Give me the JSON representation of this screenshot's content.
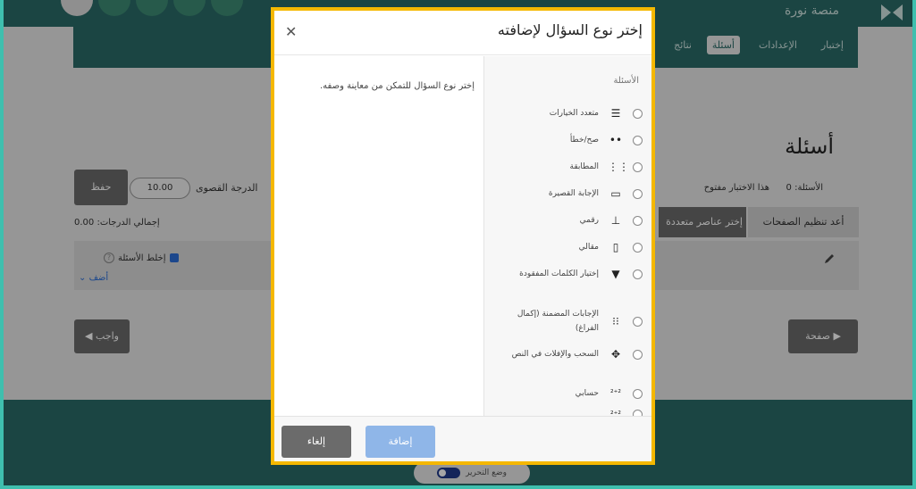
{
  "app": {
    "brand": "منصة نورة"
  },
  "tabs": [
    {
      "label": "إختبار"
    },
    {
      "label": "الإعدادات"
    },
    {
      "label": "أسئلة"
    },
    {
      "label": "نتائج"
    }
  ],
  "page": {
    "title": "أسئلة",
    "questions_count": "الأسئلة: 0",
    "quiz_open": "هذا الاختبار مفتوح",
    "max_grade_label": "الدرجة القصوى",
    "max_grade_value": "10.00",
    "save": "حفظ",
    "total_grades": "إجمالي الدرجات: 0.00",
    "reorder_pages": "أعد تنظيم الصفحات",
    "select_multiple": "إختر عناصر متعددة",
    "shuffle_questions": "إخلط الأسئلة",
    "add": "أضف",
    "page_btn": "صفحة",
    "required_btn": "واجب",
    "edit_mode": "وضع التحرير"
  },
  "modal": {
    "title": "إختر نوع السؤال لإضافته",
    "list_heading": "الأسئلة",
    "description": "إختر نوع السؤال للتمكن من معاينة وصفه.",
    "add_button": "إضافة",
    "cancel_button": "إلغاء",
    "question_types": [
      {
        "label": "متعدد الخيارات",
        "icon": "list-bullets-icon",
        "glyph": "☰"
      },
      {
        "label": "صح/خطأ",
        "icon": "two-dots-icon",
        "glyph": "••"
      },
      {
        "label": "المطابقة",
        "icon": "matching-grid-icon",
        "glyph": "⋮⋮"
      },
      {
        "label": "الإجابة القصيرة",
        "icon": "short-answer-icon",
        "glyph": "▭"
      },
      {
        "label": "رقمي",
        "icon": "numeric-icon",
        "glyph": "⊥"
      },
      {
        "label": "مقالي",
        "icon": "essay-icon",
        "glyph": "▯"
      },
      {
        "label": "إختيار الكلمات المفقودة",
        "icon": "dropdown-icon",
        "glyph": "▼"
      },
      {
        "label": "الإجابات المضمنة (إكمال الفراغ)",
        "icon": "embedded-answers-icon",
        "glyph": "⁝⁝"
      },
      {
        "label": "السحب والإفلات في النص",
        "icon": "drag-drop-icon",
        "glyph": "✥"
      },
      {
        "label": "حسابي",
        "icon": "calculated-icon",
        "glyph": "²⁺²"
      },
      {
        "label": "",
        "icon": "calculated-multi-icon",
        "glyph": "²⁺²"
      }
    ]
  }
}
